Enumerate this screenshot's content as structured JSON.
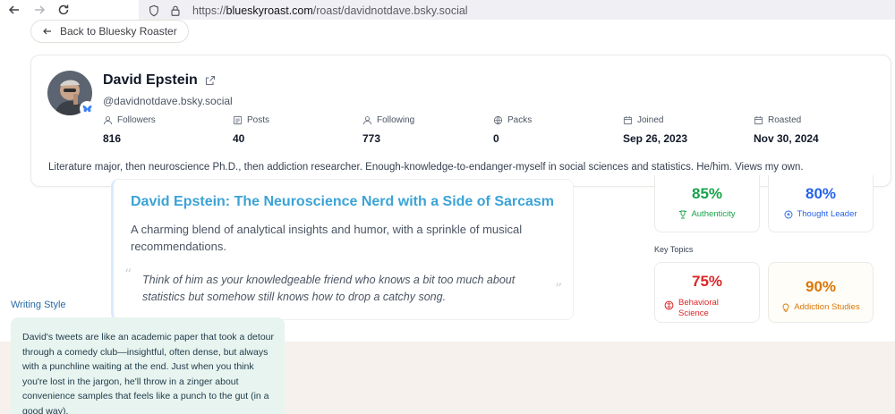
{
  "browser": {
    "url_scheme": "https://",
    "url_host": "blueskyroast.com",
    "url_path": "/roast/davidnotdave.bsky.social"
  },
  "back_link": "Back to Bluesky Roaster",
  "profile": {
    "name": "David Epstein",
    "handle": "@davidnotdave.bsky.social",
    "stats": [
      {
        "label": "Followers",
        "value": "816",
        "icon": "user-icon"
      },
      {
        "label": "Posts",
        "value": "40",
        "icon": "document-icon"
      },
      {
        "label": "Following",
        "value": "773",
        "icon": "user-icon"
      },
      {
        "label": "Packs",
        "value": "0",
        "icon": "globe-icon"
      },
      {
        "label": "Joined",
        "value": "Sep 26, 2023",
        "icon": "calendar-icon"
      },
      {
        "label": "Roasted",
        "value": "Nov 30, 2024",
        "icon": "calendar-icon"
      }
    ],
    "bio": "Literature major, then neuroscience Ph.D., then addiction researcher.  Enough-knowledge-to-endanger-myself in social sciences and statistics.  He/him.  Views my own."
  },
  "roast": {
    "title": "David Epstein: The Neuroscience Nerd with a Side of Sarcasm",
    "description": "A charming blend of analytical insights and humor, with a sprinkle of musical recommendations.",
    "quote": "Think of him as your knowledgeable friend who knows a bit too much about statistics but somehow still knows how to drop a catchy song."
  },
  "metrics": [
    {
      "value": "85%",
      "label": "Authenticity",
      "icon": "trophy-icon",
      "color": "#16a34a"
    },
    {
      "value": "80%",
      "label": "Thought Leader",
      "icon": "lightbulb-icon",
      "color": "#2563eb"
    }
  ],
  "key_topics_label": "Key Topics",
  "topics": [
    {
      "value": "75%",
      "label_line1": "Behavioral",
      "label_line2": "Science",
      "icon": "brain-icon",
      "color": "#dc2626"
    },
    {
      "value": "90%",
      "label": "Addiction Studies",
      "icon": "lightbulb-icon",
      "color": "#d97706"
    }
  ],
  "writing_style": {
    "title": "Writing Style",
    "text": "David's tweets are like an academic paper that took a detour through a comedy club—insightful, often dense, but always with a punchline waiting at the end. Just when you think you're lost in the jargon, he'll throw in a zinger about convenience samples that feels like a punch to the gut (in a good way)."
  },
  "colors": {
    "accent_title": "#3ba3d6",
    "writing_style_bg": "#e8f4ef"
  }
}
